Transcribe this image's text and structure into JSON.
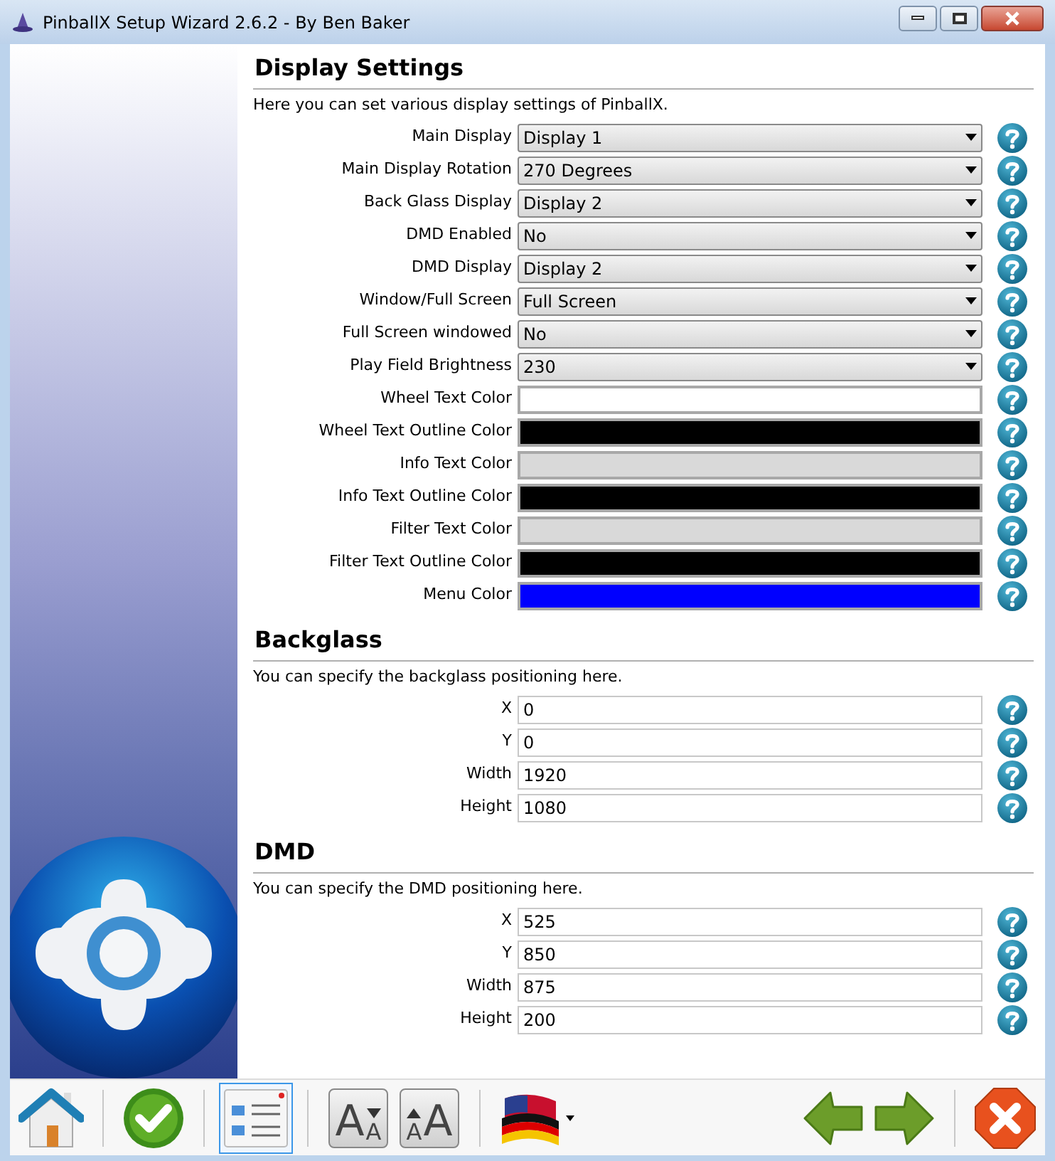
{
  "window": {
    "title": "PinballX Setup Wizard 2.6.2 - By Ben Baker"
  },
  "sections": [
    {
      "title": "Display Settings",
      "description": "Here you can set various display settings of PinballX.",
      "rows": [
        {
          "label": "Main Display",
          "kind": "select",
          "value": "Display 1"
        },
        {
          "label": "Main Display Rotation",
          "kind": "select",
          "value": "270 Degrees"
        },
        {
          "label": "Back Glass Display",
          "kind": "select",
          "value": "Display 2"
        },
        {
          "label": "DMD Enabled",
          "kind": "select",
          "value": "No"
        },
        {
          "label": "DMD Display",
          "kind": "select",
          "value": "Display 2"
        },
        {
          "label": "Window/Full Screen",
          "kind": "select",
          "value": "Full Screen"
        },
        {
          "label": "Full Screen windowed",
          "kind": "select",
          "value": "No"
        },
        {
          "label": "Play Field Brightness",
          "kind": "select",
          "value": "230"
        },
        {
          "label": "Wheel Text Color",
          "kind": "color",
          "color": "#ffffff"
        },
        {
          "label": "Wheel Text Outline Color",
          "kind": "color",
          "color": "#000000"
        },
        {
          "label": "Info Text Color",
          "kind": "color",
          "color": "#d9d9d9"
        },
        {
          "label": "Info Text Outline Color",
          "kind": "color",
          "color": "#000000"
        },
        {
          "label": "Filter Text Color",
          "kind": "color",
          "color": "#d9d9d9"
        },
        {
          "label": "Filter Text Outline Color",
          "kind": "color",
          "color": "#000000"
        },
        {
          "label": "Menu Color",
          "kind": "color",
          "color": "#0000ff"
        }
      ]
    },
    {
      "title": "Backglass",
      "description": "You can specify the backglass positioning here.",
      "rows": [
        {
          "label": "X",
          "kind": "text",
          "value": "0"
        },
        {
          "label": "Y",
          "kind": "text",
          "value": "0"
        },
        {
          "label": "Width",
          "kind": "text",
          "value": "1920"
        },
        {
          "label": "Height",
          "kind": "text",
          "value": "1080"
        }
      ]
    },
    {
      "title": "DMD",
      "description": "You can specify the DMD positioning here.",
      "rows": [
        {
          "label": "X",
          "kind": "text",
          "value": "525"
        },
        {
          "label": "Y",
          "kind": "text",
          "value": "850"
        },
        {
          "label": "Width",
          "kind": "text",
          "value": "875"
        },
        {
          "label": "Height",
          "kind": "text",
          "value": "200"
        }
      ]
    }
  ],
  "toolbar": [
    {
      "kind": "home",
      "selected": false
    },
    {
      "kind": "finish",
      "selected": false
    },
    {
      "kind": "list",
      "selected": true
    },
    {
      "kind": "font-smaller",
      "selected": false,
      "big": "A",
      "small": "A"
    },
    {
      "kind": "font-larger",
      "selected": false,
      "big": "A",
      "small": "A"
    },
    {
      "kind": "language",
      "selected": false
    },
    {
      "kind": "back",
      "selected": false
    },
    {
      "kind": "forward",
      "selected": false
    },
    {
      "kind": "cancel",
      "selected": false
    }
  ]
}
